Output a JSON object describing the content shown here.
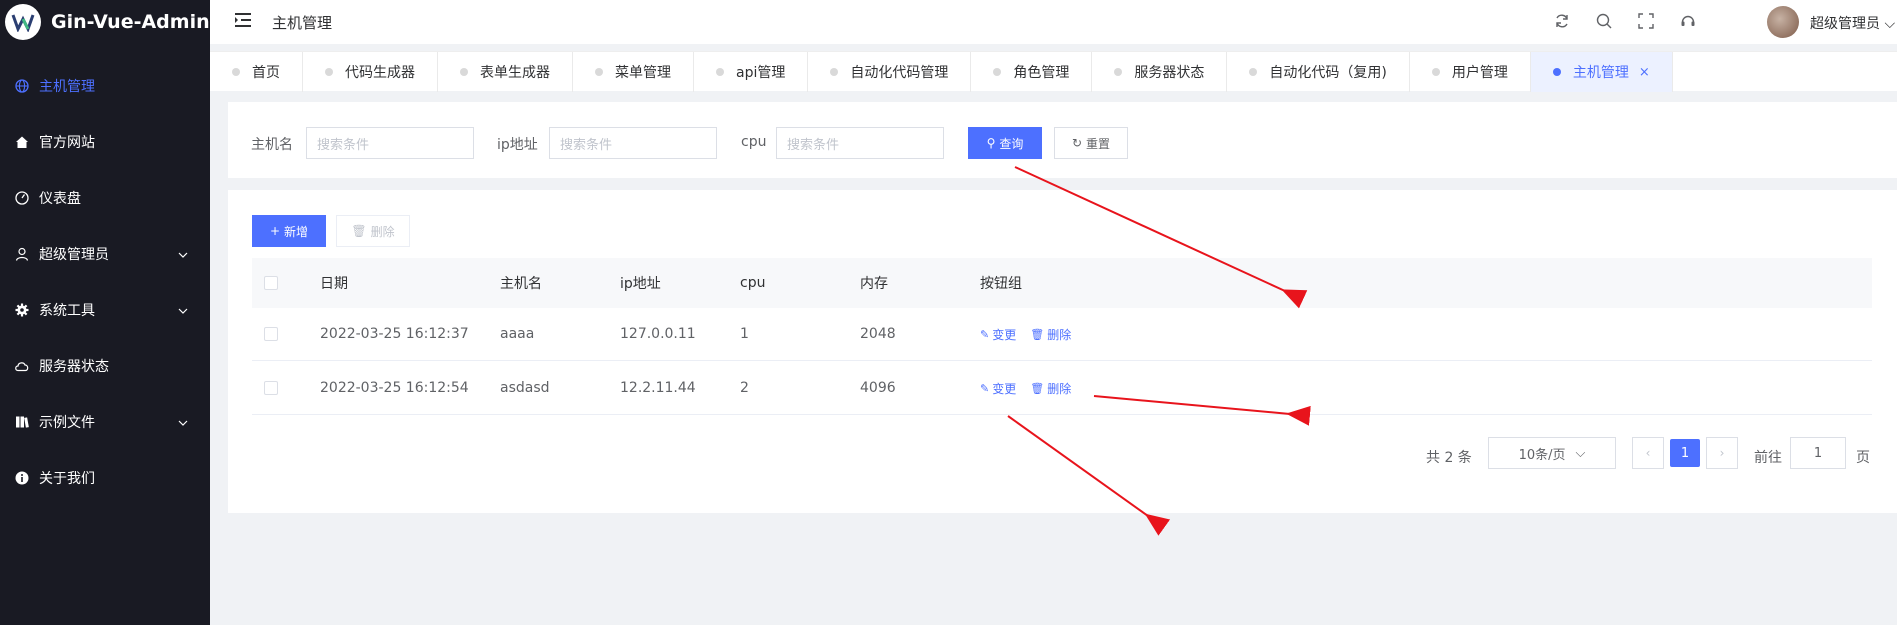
{
  "app": {
    "logo_text": "Gin-Vue-Admin"
  },
  "sidebar": {
    "items": [
      {
        "label": "主机管理",
        "icon": "globe-icon",
        "active": true
      },
      {
        "label": "官方网站",
        "icon": "home-icon"
      },
      {
        "label": "仪表盘",
        "icon": "dashboard-icon"
      },
      {
        "label": "超级管理员",
        "icon": "user-icon",
        "expandable": true
      },
      {
        "label": "系统工具",
        "icon": "gear-icon",
        "expandable": true
      },
      {
        "label": "服务器状态",
        "icon": "cloud-icon"
      },
      {
        "label": "示例文件",
        "icon": "folder-icon",
        "expandable": true
      },
      {
        "label": "关于我们",
        "icon": "info-icon"
      }
    ]
  },
  "header": {
    "title": "主机管理",
    "user_name": "超级管理员",
    "icons": [
      "refresh-icon",
      "search-icon",
      "fullscreen-icon",
      "support-icon"
    ]
  },
  "tabs": [
    {
      "label": "首页"
    },
    {
      "label": "代码生成器"
    },
    {
      "label": "表单生成器"
    },
    {
      "label": "菜单管理"
    },
    {
      "label": "api管理"
    },
    {
      "label": "自动化代码管理"
    },
    {
      "label": "角色管理"
    },
    {
      "label": "服务器状态"
    },
    {
      "label": "自动化代码（复用)"
    },
    {
      "label": "用户管理"
    },
    {
      "label": "主机管理",
      "active": true,
      "close": "×"
    }
  ],
  "search": {
    "hostname_label": "主机名",
    "ip_label": "ip地址",
    "cpu_label": "cpu",
    "placeholder": "搜索条件",
    "query_button": "查询",
    "reset_button": "重置"
  },
  "toolbar": {
    "add_button": "新增",
    "delete_button": "删除"
  },
  "table": {
    "columns": [
      "日期",
      "主机名",
      "ip地址",
      "cpu",
      "内存",
      "按钮组"
    ],
    "rows": [
      {
        "date": "2022-03-25 16:12:37",
        "host": "aaaa",
        "ip": "127.0.0.11",
        "cpu": "1",
        "mem": "2048"
      },
      {
        "date": "2022-03-25 16:12:54",
        "host": "asdasd",
        "ip": "12.2.11.44",
        "cpu": "2",
        "mem": "4096"
      }
    ],
    "edit_label": "变更",
    "delete_label": "删除"
  },
  "pagination": {
    "total_text": "共 2 条",
    "page_size": "10条/页",
    "current_page": "1",
    "goto_label": "前往",
    "goto_value": "1",
    "page_suffix": "页"
  },
  "colors": {
    "accent": "#4d70ff",
    "sidebar_bg": "#191a23",
    "annotation": "#e8141c"
  }
}
